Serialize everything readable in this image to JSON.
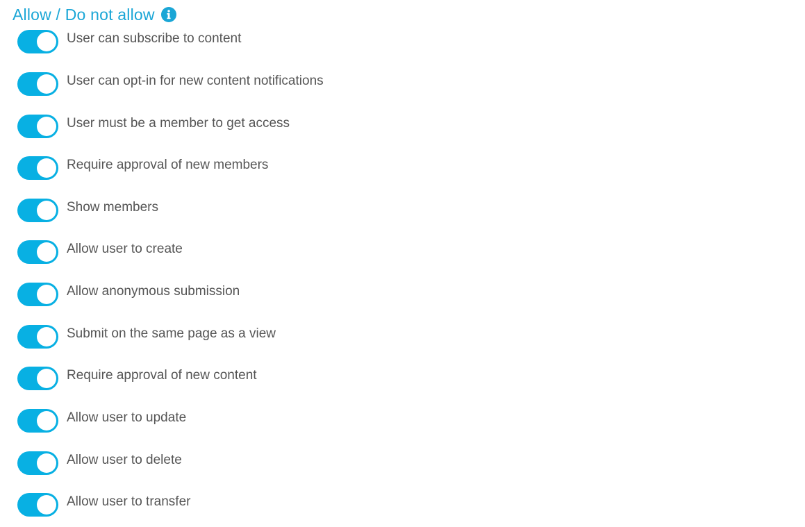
{
  "section": {
    "title": "Allow / Do not allow",
    "info_icon": "info-icon"
  },
  "colors": {
    "accent": "#1aa6d6",
    "toggle_on": "#08b0e3",
    "label_text": "#555555"
  },
  "toggles": [
    {
      "label": "User can subscribe to content",
      "enabled": true
    },
    {
      "label": "User can opt-in for new content notifications",
      "enabled": true
    },
    {
      "label": "User must be a member to get access",
      "enabled": true
    },
    {
      "label": "Require approval of new members",
      "enabled": true
    },
    {
      "label": "Show members",
      "enabled": true
    },
    {
      "label": "Allow user to create",
      "enabled": true
    },
    {
      "label": "Allow anonymous submission",
      "enabled": true
    },
    {
      "label": "Submit on the same page as a view",
      "enabled": true
    },
    {
      "label": "Require approval of new content",
      "enabled": true
    },
    {
      "label": "Allow user to update",
      "enabled": true
    },
    {
      "label": "Allow user to delete",
      "enabled": true
    },
    {
      "label": "Allow user to transfer",
      "enabled": true
    }
  ]
}
